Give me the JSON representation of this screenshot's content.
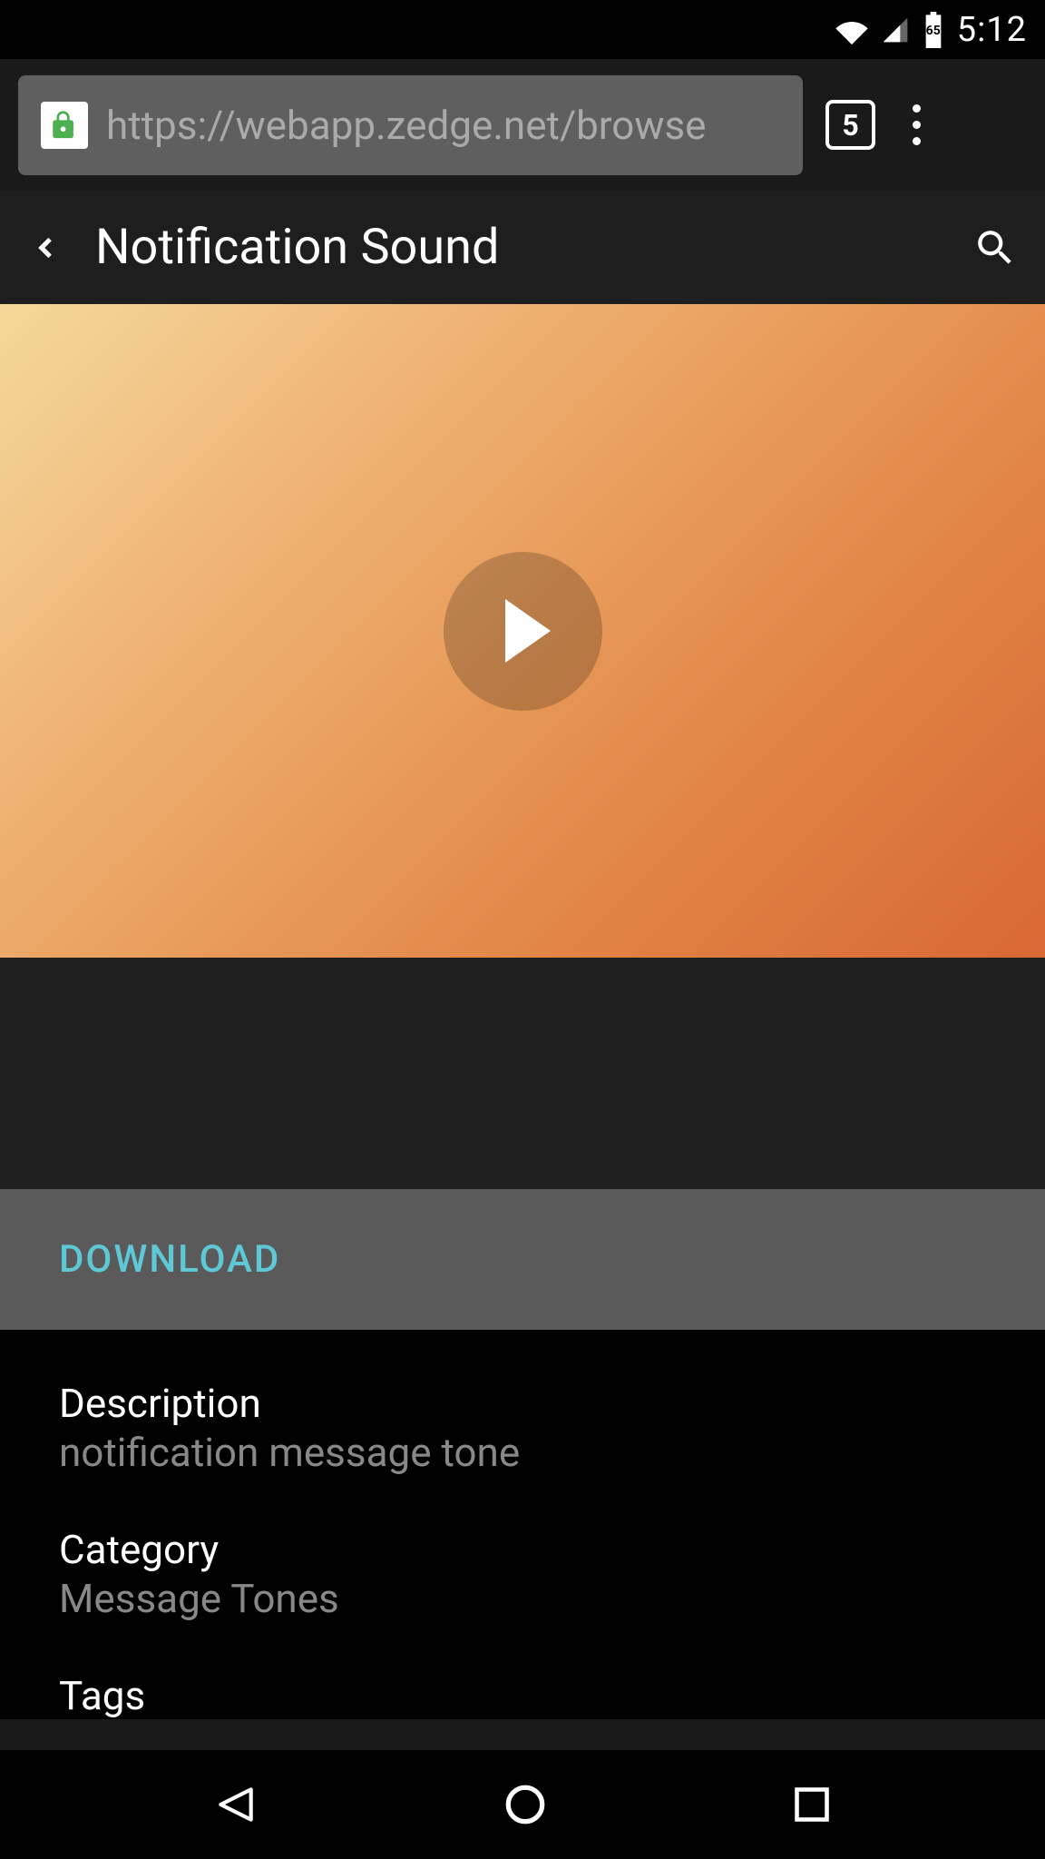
{
  "status_bar": {
    "time": "5:12",
    "battery_level": "65"
  },
  "browser": {
    "url": "https://webapp.zedge.net/browse",
    "tab_count": "5"
  },
  "header": {
    "title": "Notification Sound"
  },
  "download": {
    "label": "DOWNLOAD"
  },
  "details": {
    "description_label": "Description",
    "description_value": "notification message tone",
    "category_label": "Category",
    "category_value": "Message Tones",
    "tags_label": "Tags"
  },
  "colors": {
    "accent": "#5fc8d6",
    "gradient_start": "#f5d99a",
    "gradient_end": "#d86835"
  }
}
